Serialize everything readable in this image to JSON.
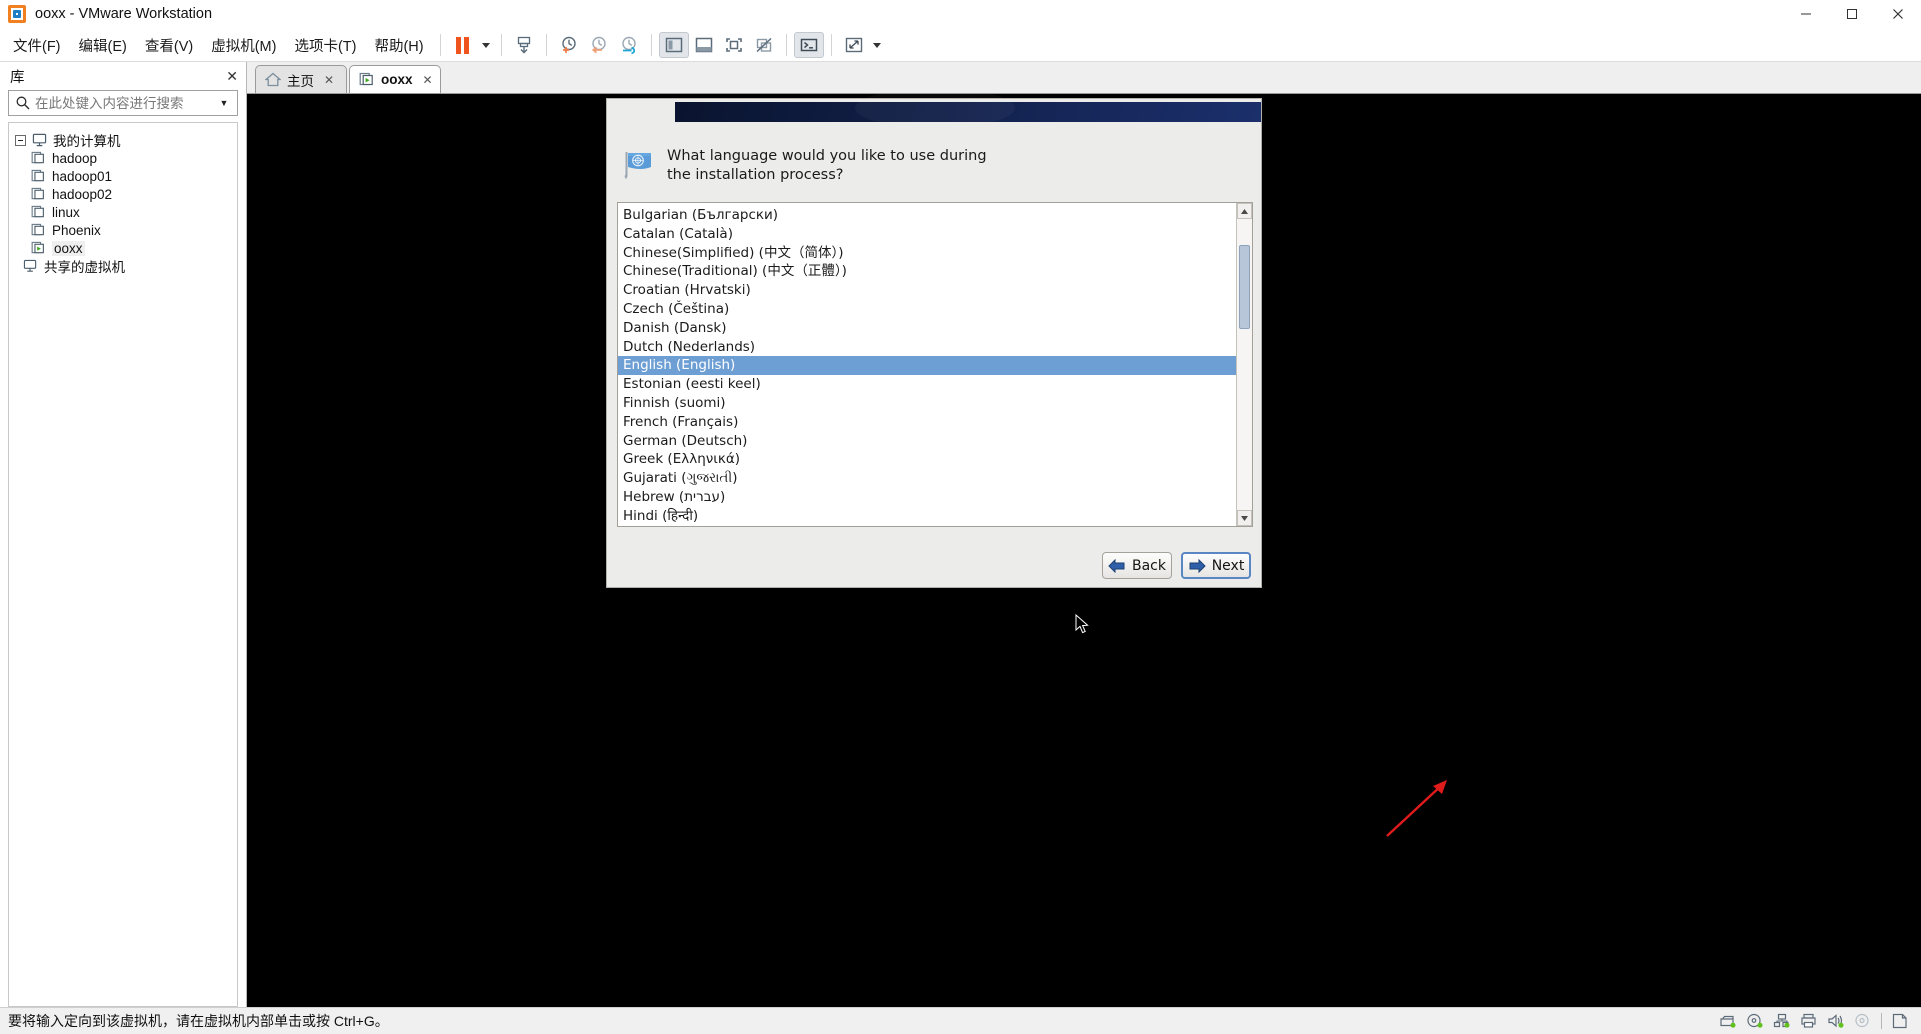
{
  "window": {
    "title": "ooxx - VMware Workstation",
    "app_icon": "vmware-logo-icon",
    "minimize_label": "Minimize",
    "maximize_label": "Maximize",
    "close_label": "Close"
  },
  "menubar": {
    "items": [
      {
        "label": "文件(F)",
        "name": "menu-file"
      },
      {
        "label": "编辑(E)",
        "name": "menu-edit"
      },
      {
        "label": "查看(V)",
        "name": "menu-view"
      },
      {
        "label": "虚拟机(M)",
        "name": "menu-vm"
      },
      {
        "label": "选项卡(T)",
        "name": "menu-tabs"
      },
      {
        "label": "帮助(H)",
        "name": "menu-help"
      }
    ]
  },
  "toolbar": {
    "buttons": [
      {
        "name": "suspend-button",
        "icon": "pause-icon",
        "title": "挂起"
      },
      {
        "name": "power-dropdown",
        "icon": "chevron-down-icon",
        "title": "电源"
      },
      {
        "name": "snapshot-button",
        "icon": "snapshot-save-icon",
        "title": "拍摄快照"
      },
      {
        "name": "snapshot-take-button",
        "icon": "clock-plus-icon",
        "title": "快照"
      },
      {
        "name": "snapshot-revert-button",
        "icon": "clock-back-icon",
        "title": "恢复快照"
      },
      {
        "name": "snapshot-manager-button",
        "icon": "clock-wrench-icon",
        "title": "快照管理器"
      },
      {
        "name": "show-library-button",
        "icon": "panel-left-icon",
        "title": "显示或隐藏库"
      },
      {
        "name": "show-thumbnail-button",
        "icon": "panel-bottom-icon",
        "title": "显示缩略图栏"
      },
      {
        "name": "fullscreen-button",
        "icon": "fullscreen-icon",
        "title": "进入全屏"
      },
      {
        "name": "unity-button",
        "icon": "unity-off-icon",
        "title": "Unity 模式"
      },
      {
        "name": "console-button",
        "icon": "terminal-icon",
        "title": "控制台视图"
      },
      {
        "name": "stretch-button",
        "icon": "resize-diagonal-icon",
        "title": "适应客户机"
      },
      {
        "name": "stretch-dropdown",
        "icon": "chevron-down-icon",
        "title": "更多"
      }
    ]
  },
  "sidebar": {
    "title": "库",
    "close_icon": "close-icon",
    "search": {
      "placeholder": "在此处键入内容进行搜索",
      "value": "",
      "icon": "search-icon",
      "dropdown_icon": "chevron-down-icon"
    },
    "tree": [
      {
        "label": "我的计算机",
        "icon": "computer-icon",
        "level": 0,
        "expander": true,
        "selected": false
      },
      {
        "label": "hadoop",
        "icon": "vm-icon",
        "level": 1,
        "selected": false
      },
      {
        "label": "hadoop01",
        "icon": "vm-icon",
        "level": 1,
        "selected": false
      },
      {
        "label": "hadoop02",
        "icon": "vm-icon",
        "level": 1,
        "selected": false
      },
      {
        "label": "linux",
        "icon": "vm-icon",
        "level": 1,
        "selected": false
      },
      {
        "label": "Phoenix",
        "icon": "vm-icon",
        "level": 1,
        "selected": false
      },
      {
        "label": "ooxx",
        "icon": "vm-running-icon",
        "level": 1,
        "selected": true
      },
      {
        "label": "共享的虚拟机",
        "icon": "shared-vm-icon",
        "level": 0,
        "selected": false
      }
    ]
  },
  "tabs": [
    {
      "label": "主页",
      "icon": "home-icon",
      "active": false,
      "close_icon": "close-icon"
    },
    {
      "label": "ooxx",
      "icon": "vm-running-icon",
      "active": true,
      "close_icon": "close-icon"
    }
  ],
  "installer": {
    "banner_color": "#111f46",
    "prompt": "What language would you like to use during the installation process?",
    "prompt_icon": "un-flag-icon",
    "languages": [
      {
        "label": "Bulgarian (Български)",
        "selected": false
      },
      {
        "label": "Catalan (Català)",
        "selected": false
      },
      {
        "label": "Chinese(Simplified) (中文（简体）)",
        "selected": false
      },
      {
        "label": "Chinese(Traditional) (中文（正體）)",
        "selected": false
      },
      {
        "label": "Croatian (Hrvatski)",
        "selected": false
      },
      {
        "label": "Czech (Čeština)",
        "selected": false
      },
      {
        "label": "Danish (Dansk)",
        "selected": false
      },
      {
        "label": "Dutch (Nederlands)",
        "selected": false
      },
      {
        "label": "English (English)",
        "selected": true
      },
      {
        "label": "Estonian (eesti keel)",
        "selected": false
      },
      {
        "label": "Finnish (suomi)",
        "selected": false
      },
      {
        "label": "French (Français)",
        "selected": false
      },
      {
        "label": "German (Deutsch)",
        "selected": false
      },
      {
        "label": "Greek (Ελληνικά)",
        "selected": false
      },
      {
        "label": "Gujarati (ગુજરાતી)",
        "selected": false
      },
      {
        "label": "Hebrew (עברית)",
        "selected": false
      },
      {
        "label": "Hindi (हिन्दी)",
        "selected": false
      }
    ],
    "scroll_up_icon": "caret-up-icon",
    "scroll_down_icon": "caret-down-icon",
    "back_button": "Back",
    "next_button": "Next",
    "back_icon": "arrow-left-icon",
    "next_icon": "arrow-right-icon",
    "annotation_icon": "red-arrow-annotation"
  },
  "statusbar": {
    "message": "要将输入定向到该虚拟机，请在虚拟机内部单击或按 Ctrl+G。",
    "icons": [
      {
        "name": "hard-disk-status-icon"
      },
      {
        "name": "cd-dvd-status-icon"
      },
      {
        "name": "network-status-icon"
      },
      {
        "name": "printer-status-icon"
      },
      {
        "name": "sound-status-icon"
      },
      {
        "name": "usb-status-icon"
      },
      {
        "name": "message-log-icon"
      }
    ]
  },
  "colors": {
    "accent": "#6e9fd4",
    "banner": "#111f46",
    "orange": "#f0541e",
    "annotation": "#e01b1b"
  }
}
